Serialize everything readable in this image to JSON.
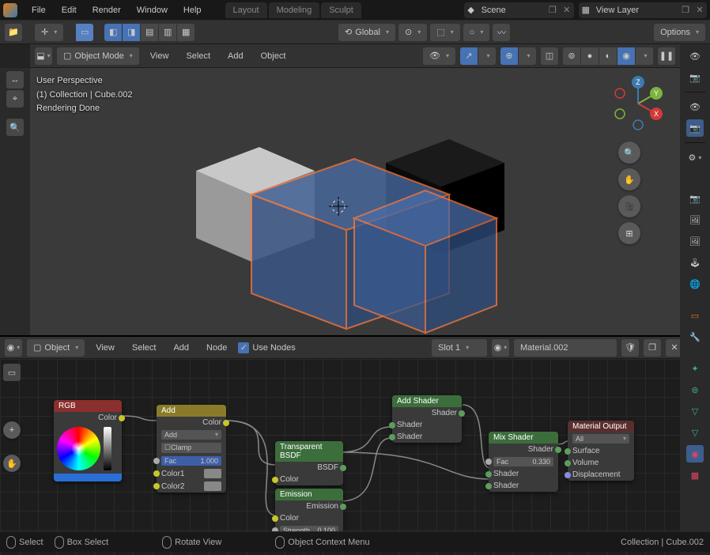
{
  "topmenu": {
    "file": "File",
    "edit": "Edit",
    "render": "Render",
    "window": "Window",
    "help": "Help"
  },
  "workspaces": {
    "layout": "Layout",
    "modeling": "Modeling",
    "sculpting": "Sculpt"
  },
  "scene": {
    "label": "Scene",
    "viewlayer": "View Layer"
  },
  "toolbar2": {
    "global": "Global",
    "options": "Options"
  },
  "vpheader": {
    "mode": "Object Mode",
    "view": "View",
    "select": "Select",
    "add": "Add",
    "object": "Object"
  },
  "vpinfo": {
    "l1": "User Perspective",
    "l2": "(1) Collection | Cube.002",
    "l3": "Rendering Done"
  },
  "neheader": {
    "object": "Object",
    "view": "View",
    "select": "Select",
    "add": "Add",
    "node": "Node",
    "usenodes": "Use Nodes",
    "slot": "Slot 1",
    "material": "Material.002"
  },
  "nodes": {
    "rgb": {
      "title": "RGB",
      "color": "Color"
    },
    "add": {
      "title": "Add",
      "color": "Color",
      "mode": "Add",
      "clamp": "Clamp",
      "fac": "Fac",
      "facv": "1.000",
      "c1": "Color1",
      "c2": "Color2"
    },
    "tbsdf": {
      "title": "Transparent BSDF",
      "bsdf": "BSDF",
      "color": "Color"
    },
    "emit": {
      "title": "Emission",
      "emission": "Emission",
      "color": "Color",
      "strength": "Strength",
      "strengthv": "0.100"
    },
    "addsh": {
      "title": "Add Shader",
      "shader": "Shader"
    },
    "mixsh": {
      "title": "Mix Shader",
      "shader": "Shader",
      "fac": "Fac",
      "facv": "0.330"
    },
    "out": {
      "title": "Material Output",
      "all": "All",
      "surface": "Surface",
      "volume": "Volume",
      "disp": "Displacement"
    }
  },
  "ne_material_label": "Material.002",
  "status": {
    "select": "Select",
    "box": "Box Select",
    "rotate": "Rotate View",
    "ctx": "Object Context Menu",
    "info": "Collection | Cube.002"
  }
}
